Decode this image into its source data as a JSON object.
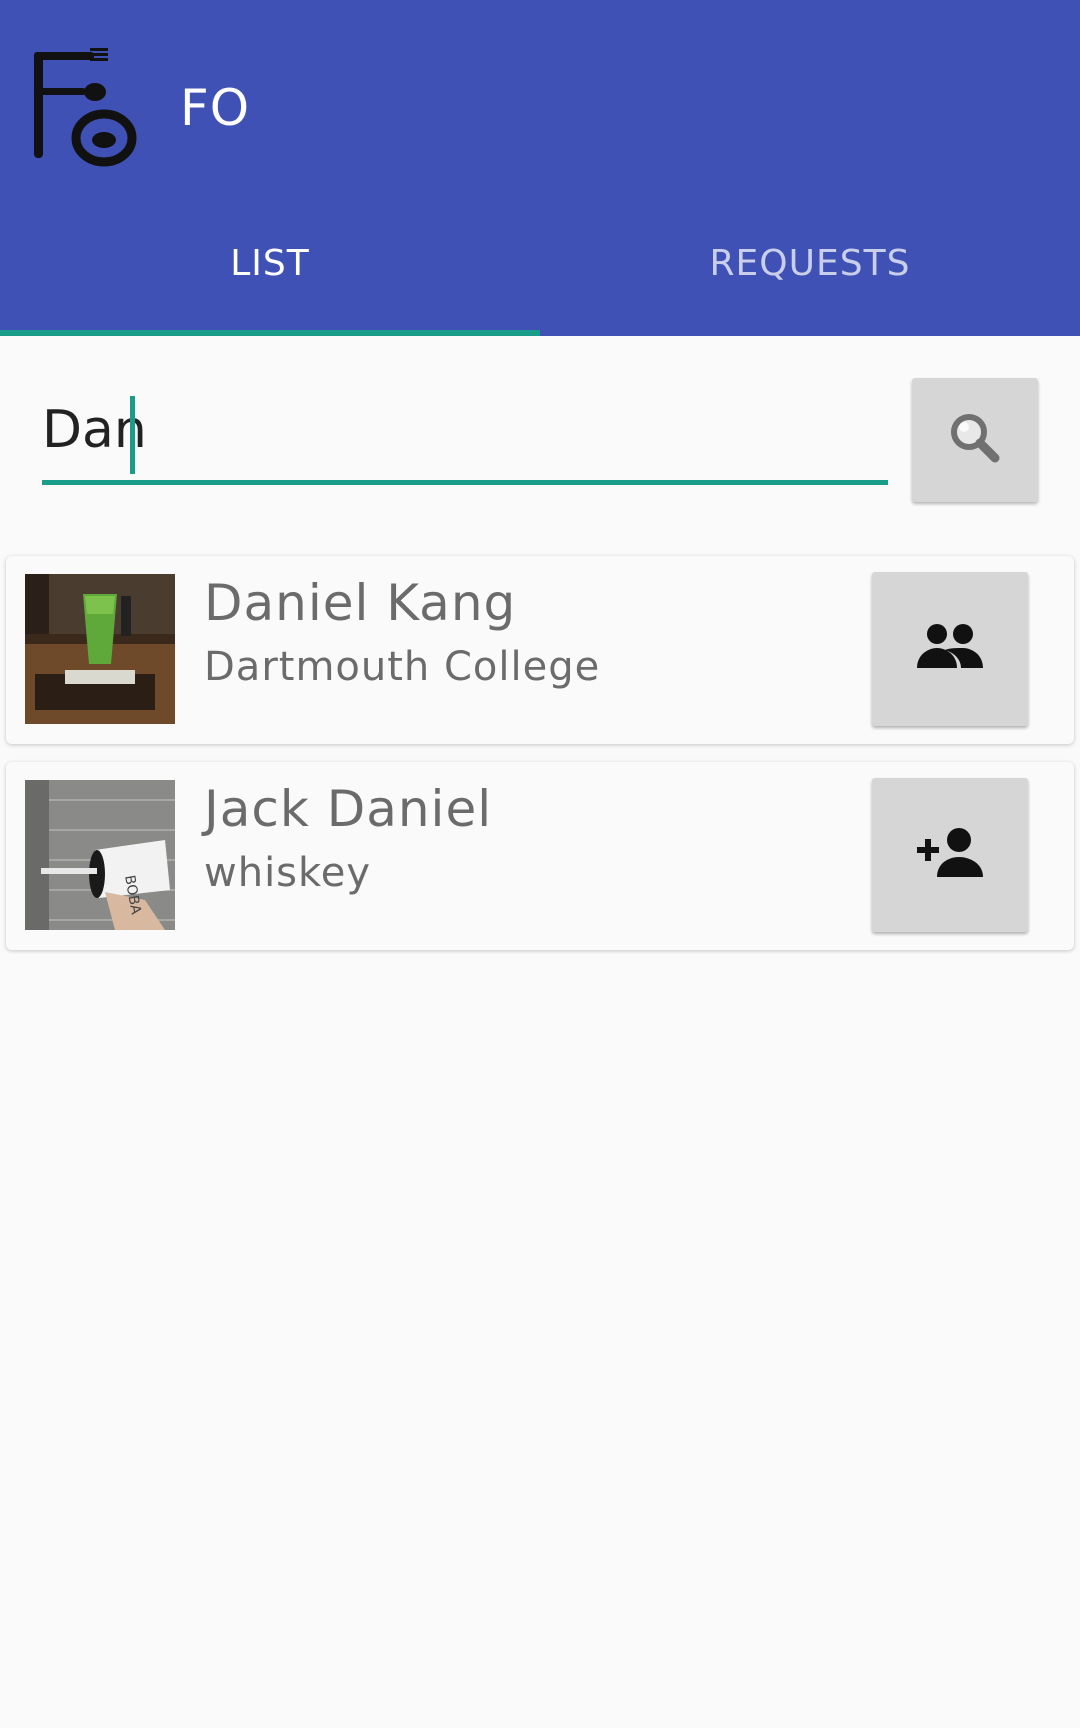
{
  "app": {
    "title": "FO",
    "logo_icon": "fork-spoon-plate-logo",
    "bar_color": "#3f51b5",
    "accent_color": "#1a9c8a"
  },
  "tabs": [
    {
      "label": "LIST",
      "active": true
    },
    {
      "label": "REQUESTS",
      "active": false
    }
  ],
  "search": {
    "value": "Dan",
    "button_icon": "search-icon"
  },
  "results": [
    {
      "name": "Daniel Kang",
      "subtitle": "Dartmouth College",
      "thumbnail": "green-drink-photo",
      "action_icon": "people-icon"
    },
    {
      "name": "Jack Daniel",
      "subtitle": "whiskey",
      "thumbnail": "coffee-cup-photo",
      "action_icon": "add-person-icon"
    }
  ]
}
